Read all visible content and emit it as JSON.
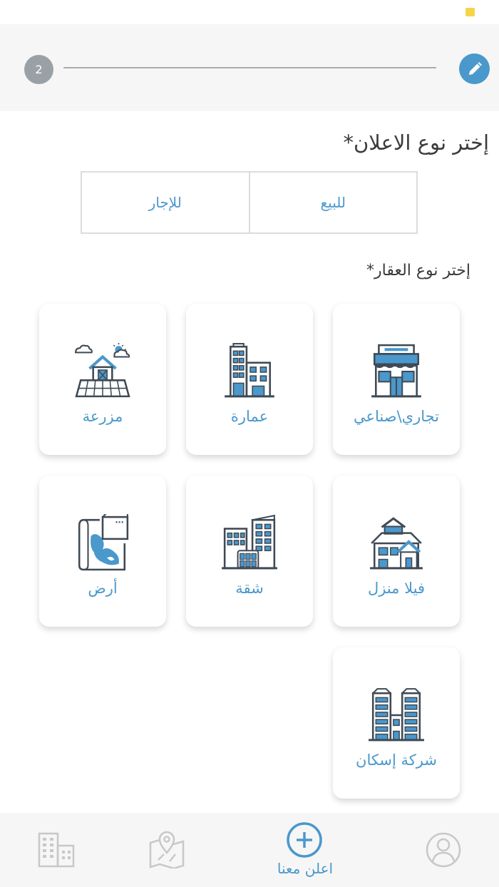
{
  "stepper": {
    "step_number": "2"
  },
  "ad_type": {
    "title": "إختر نوع الاعلان*",
    "options": [
      "للبيع",
      "للإجار"
    ]
  },
  "property_type": {
    "title": "إختر نوع العقار*",
    "items": [
      {
        "label": "تجاري\\صناعي",
        "icon": "shop-icon"
      },
      {
        "label": "عمارة",
        "icon": "building-icon"
      },
      {
        "label": "مزرعة",
        "icon": "farm-icon"
      },
      {
        "label": "فيلا منزل",
        "icon": "villa-icon"
      },
      {
        "label": "شقة",
        "icon": "apartment-icon"
      },
      {
        "label": "أرض",
        "icon": "land-map-icon"
      },
      {
        "label": "شركة إسكان",
        "icon": "housing-company-icon"
      }
    ]
  },
  "bottom_nav": {
    "advertise_label": "اعلن معنا",
    "icons": [
      "buildings-icon",
      "map-pin-icon",
      "add-circle-icon",
      "profile-icon"
    ]
  },
  "colors": {
    "accent": "#4a98cc",
    "icon_dark": "#3f4a55",
    "nav_inactive": "#c8c8c8"
  }
}
